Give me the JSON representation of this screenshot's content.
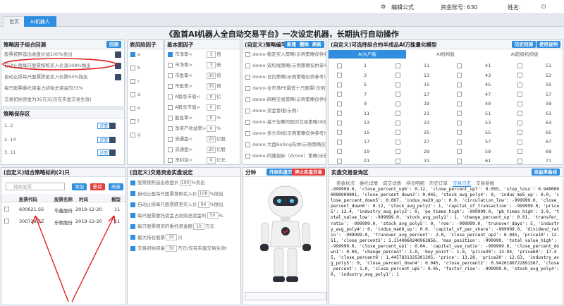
{
  "topbar": {
    "edit_formula": "编辑公式",
    "account": "资金账号: 630",
    "name": "姓名: "
  },
  "tabs": [
    {
      "label": "首页"
    },
    {
      "label": "AI机器人"
    }
  ],
  "title": "《盈首AI机器人全自动交易平台》一次设定机器，长期执行自动操作",
  "p1": {
    "title": "策略因子组合回测",
    "btn": "回测",
    "rows": [
      "股票按照选出收盘价加100%卖出",
      "自动止盈每只股票按照买入价涨108%抛出",
      "自动止损每只股票跌至买入价跌94%抛出",
      "每只股票委托资金占初始总资金的33%",
      "交易初始资金为35万元(仅在实盘交易生效)"
    ]
  },
  "p2": {
    "title": "策略保存区",
    "items": [
      "1. 2",
      "2. 14",
      "3. 11"
    ],
    "detail": "详情",
    "load": "回测"
  },
  "p3": {
    "title": "表风险因子",
    "labels": [
      "a",
      "b",
      "c",
      "d",
      "e",
      "f",
      "g"
    ]
  },
  "p4": {
    "title": "基本面因子",
    "rows": [
      {
        "n": "市净率<",
        "v": "3",
        "u": "倍"
      },
      {
        "n": "市净率>",
        "v": "3",
        "u": "倍"
      },
      {
        "n": "市盈率<",
        "v": "30",
        "u": "倍"
      },
      {
        "n": "市盈率>",
        "v": "30",
        "u": "倍"
      },
      {
        "n": "A股总市值<",
        "v": "0",
        "u": "亿"
      },
      {
        "n": "A股总市值>",
        "v": "0",
        "u": "亿"
      },
      {
        "n": "股息率>",
        "v": "0",
        "u": "%"
      },
      {
        "n": "净资产收益率>",
        "v": "0",
        "u": "%"
      },
      {
        "n": "流通盘<",
        "v": "20",
        "u": "亿股"
      },
      {
        "n": "流通盘>",
        "v": "20",
        "u": "亿股"
      },
      {
        "n": "净利润>",
        "v": "0",
        "u": "亿元"
      }
    ]
  },
  "p5": {
    "title": "(自定义)策略编写",
    "b1": "新建",
    "b2": "删除",
    "b3": "刷新",
    "rows": [
      "demo-稳定买入策略(示例策略仅供参考)",
      "demo-双均线策略(示例策略仅供参考)",
      "demo-日内策略(示例策略仅供参考)",
      "demo-全市场PE最低十只股票(示例)",
      "demo-网格交易策略(示例策略仅供参考)",
      "demo-资金管理(示例)",
      "demo-基于协整的配对交易策略(示例)",
      "demo-多头均线(示例策略仅供参考)",
      "demo-大盘Bolling布林(示例策略仅供参考)",
      "demo-阿隆指标（Aroon）策略(示例)"
    ]
  },
  "p6": {
    "title": "(自定义)可选择组合的半成品AI万能量化模型",
    "b1": "历史回测",
    "b2": "使用说明",
    "subs": [
      "AI大户版",
      "AI机构版",
      "AI超级机构版"
    ],
    "cols": [
      [
        "1",
        "3",
        "5",
        "7",
        "9",
        "11",
        "13",
        "15",
        "17",
        "19",
        "21"
      ],
      [
        "11",
        "13",
        "15",
        "17",
        "19",
        "21",
        "23",
        "25",
        "27",
        "29",
        "31"
      ],
      [
        "41",
        "43",
        "45",
        "47",
        "49",
        "51",
        "53",
        "55",
        "57",
        "59",
        "61"
      ],
      [
        "51",
        "53",
        "55",
        "57",
        "59",
        "61",
        "63",
        "65",
        "67",
        "69",
        "71"
      ]
    ]
  },
  "p7": {
    "title": "(自定义)组合策略标的(2)只",
    "search": "搜索股票",
    "add": "添加",
    "del": "删除",
    "refresh": "刷新",
    "headers": [
      "股票代码",
      "股票名称",
      "时间",
      "模型"
    ],
    "rows": [
      [
        "600621.SS",
        "华鑫股份",
        "2019-12-20",
        "11"
      ],
      [
        "300729.SZ",
        "乐歌股份",
        "2019-12-20",
        "11"
      ]
    ]
  },
  "p8": {
    "title": "(自定义)交易资金实盘设定",
    "rows": [
      {
        "t": "股票按照选出收盘价",
        "v": "100",
        "u": "%卖出"
      },
      {
        "t": "自动止盈每只股票按照买入价",
        "v": "108",
        "u": "%抛出"
      },
      {
        "t": "自动止损每只股票跌至买入价",
        "v": "94",
        "u": "%抛出"
      },
      {
        "t": "每只股票委托资金占初始总资金的",
        "v": "50",
        "u": "%"
      },
      {
        "t": "每只股票限买的委托资金额",
        "v": "10",
        "u": "万元"
      },
      {
        "t": "最大持仓股票",
        "v": "10",
        "u": "只"
      },
      {
        "t": "交易初始资金",
        "v": "30",
        "u": "万元(仅在实盘交易生效)"
      }
    ]
  },
  "p9": {
    "title": "分钟",
    "start": "开启实盘交易",
    "stop": "停止实盘交易"
  },
  "p10": {
    "title": "实盘交易查询区",
    "btn": "收益率曲线",
    "subs": [
      "资金状况",
      "委托详情",
      "成交详情",
      "持仓明细",
      "历史订单",
      "交易日志",
      "交易参数"
    ],
    "log": "-999999.0, 'close_percent_up6': 0.12, 'close_percent_up7': 0.055, 'stop_loss': 0.9400000000000001, 'close_percent_down3': 0.045, 'stock_avg_poly4': 0, 'indus_ma5_up': 0.0, 'close_percent_down5': 0.067, 'indus_ma20_up': 0.0, 'circulation_low': -999999.0, 'close_percent_down6': 0.12, 'stock_avg_poly2': 1, 'capital_of_transaction': -999999.0, 'price5': 12.4, 'industry_avg_poly3': 0, 'pe_times_high': -999999.0, 'pb_times_high': 3.0, 'total_value_low': -999999.0, 'stock_avg_poly1': 1, 'change_percent_up': 0.01, 'transfer_ratio': -999999.0, 'stock_avg_poly5': 0, 'roe': -999999.0, 'trunover_days': 5, 'industry_avg_poly4': 0, 'indus_ma60_up': 0.0, 'capital_of_per_share': -999999.0, 'dividend_ratio': -999999.0, 'trunover_avg_percent': 2.0, 'close_percent_up2': 0.045, 'price10': 12.51, 'close_percent5': 1.3140060240963856, 'max_position': -999999, 'total_value_high': -999999.0, 'close_percent_up1': 0.04, 'capital_use_ratio': -999999.0, 'close_percent_down1': 0.04, 'change_percent': 1.0, 'buy_point': 1.0, 'price30': 13.94, 'price60': 17.45, 'close_percent6': 1.4457831325301205, 'price': 13.28, 'price20': 12.63, 'industry_avg_poly5': 0, 'close_percent_down4': 0.045, 'close_percent2': 0.9420180722891567, 'close_percent': 1.0, 'close_percent_up5': 0.05, 'factor_rise': -999999.0, 'stock_avg_poly4': 0, 'industry_avg_poly1': 1"
  }
}
